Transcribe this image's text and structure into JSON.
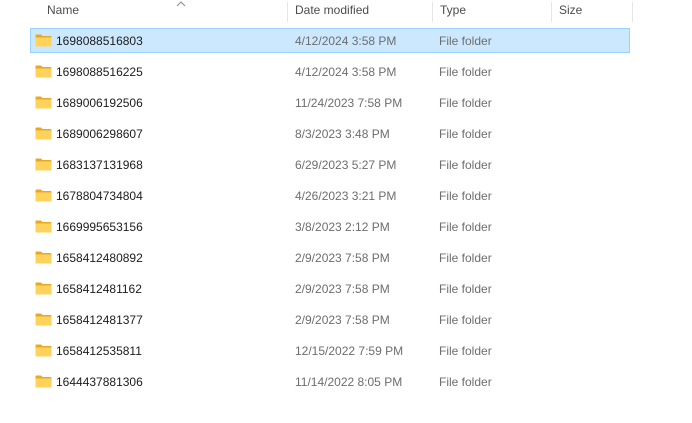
{
  "columns": {
    "name": "Name",
    "date_modified": "Date modified",
    "type": "Type",
    "size": "Size"
  },
  "colors": {
    "selected_background": "#cce8ff",
    "selected_border": "#99d1ff",
    "folder_yellow": "#ffd35b",
    "folder_dark": "#e8a922"
  },
  "files": [
    {
      "name": "1698088516803",
      "date": "4/12/2024 3:58 PM",
      "type": "File folder",
      "size": "",
      "selected": true,
      "icon": "folder-icon"
    },
    {
      "name": "1698088516225",
      "date": "4/12/2024 3:58 PM",
      "type": "File folder",
      "size": "",
      "selected": false,
      "icon": "folder-icon"
    },
    {
      "name": "1689006192506",
      "date": "11/24/2023 7:58 PM",
      "type": "File folder",
      "size": "",
      "selected": false,
      "icon": "folder-icon"
    },
    {
      "name": "1689006298607",
      "date": "8/3/2023 3:48 PM",
      "type": "File folder",
      "size": "",
      "selected": false,
      "icon": "folder-icon"
    },
    {
      "name": "1683137131968",
      "date": "6/29/2023 5:27 PM",
      "type": "File folder",
      "size": "",
      "selected": false,
      "icon": "folder-icon"
    },
    {
      "name": "1678804734804",
      "date": "4/26/2023 3:21 PM",
      "type": "File folder",
      "size": "",
      "selected": false,
      "icon": "folder-icon"
    },
    {
      "name": "1669995653156",
      "date": "3/8/2023 2:12 PM",
      "type": "File folder",
      "size": "",
      "selected": false,
      "icon": "folder-icon"
    },
    {
      "name": "1658412480892",
      "date": "2/9/2023 7:58 PM",
      "type": "File folder",
      "size": "",
      "selected": false,
      "icon": "folder-icon"
    },
    {
      "name": "1658412481162",
      "date": "2/9/2023 7:58 PM",
      "type": "File folder",
      "size": "",
      "selected": false,
      "icon": "folder-icon"
    },
    {
      "name": "1658412481377",
      "date": "2/9/2023 7:58 PM",
      "type": "File folder",
      "size": "",
      "selected": false,
      "icon": "folder-icon"
    },
    {
      "name": "1658412535811",
      "date": "12/15/2022 7:59 PM",
      "type": "File folder",
      "size": "",
      "selected": false,
      "icon": "folder-icon"
    },
    {
      "name": "1644437881306",
      "date": "11/14/2022 8:05 PM",
      "type": "File folder",
      "size": "",
      "selected": false,
      "icon": "folder-icon"
    }
  ]
}
